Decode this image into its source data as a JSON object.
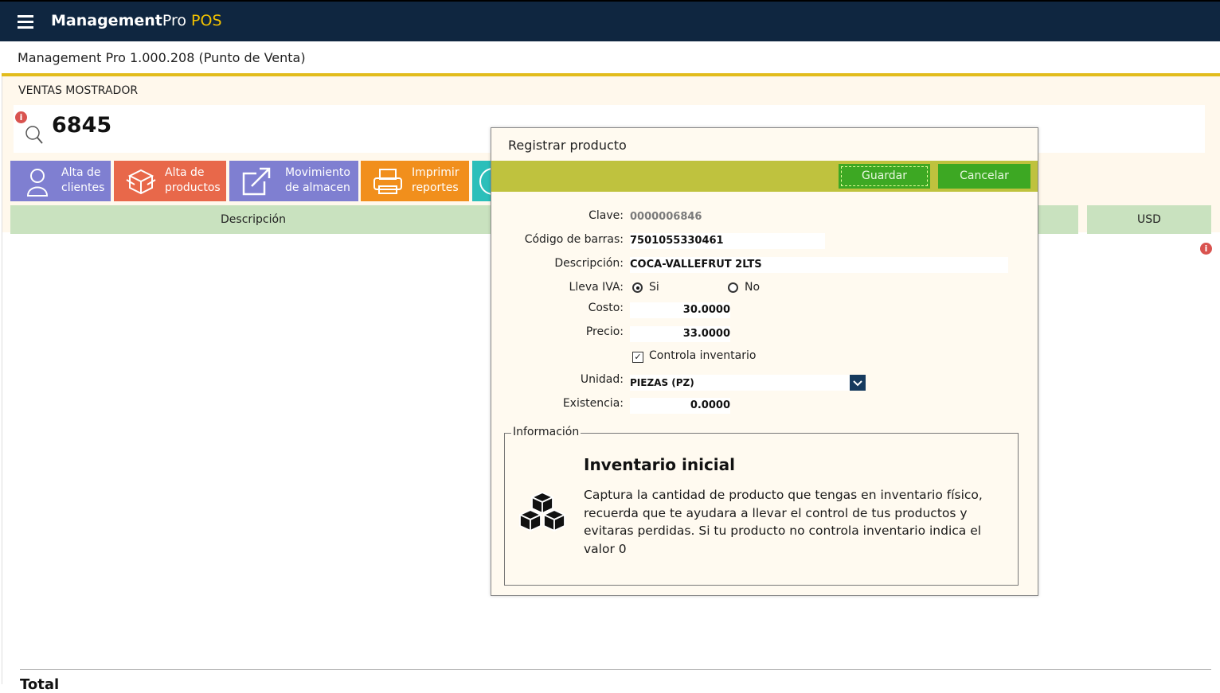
{
  "app": {
    "brand_bold": "Management",
    "brand_regular": "Pro",
    "brand_accent": " POS",
    "version": "Management Pro 1.000.208 (Punto de Venta)"
  },
  "sales": {
    "section_title": "VENTAS MOSTRADOR",
    "search_value": "6845",
    "info_icon_glyph": "i"
  },
  "tiles": [
    {
      "label": "Alta de\nclientes",
      "icon": "user-icon",
      "color": "#7f7fd1"
    },
    {
      "label": "Alta de\nproductos",
      "icon": "box-icon",
      "color": "#e8684a"
    },
    {
      "label": "Movimiento\nde almacen",
      "icon": "external-link-icon",
      "color": "#7f7fd1"
    },
    {
      "label": "Imprimir\nreportes",
      "icon": "printer-icon",
      "color": "#f18f1c"
    },
    {
      "label": "",
      "icon": "circle-icon",
      "color": "#2bbfba"
    }
  ],
  "grid": {
    "headers": [
      "Descripción",
      "USD"
    ]
  },
  "footer": {
    "total_label": "Total"
  },
  "dialog": {
    "title": "Registrar producto",
    "save_label": "Guardar",
    "cancel_label": "Cancelar",
    "fields": {
      "clave_label": "Clave:",
      "clave_value": "0000006846",
      "barcode_label": "Código de barras:",
      "barcode_value": "7501055330461",
      "description_label": "Descripción:",
      "description_value": "COCA-VALLEFRUT 2LTS",
      "iva_label": "Lleva IVA:",
      "iva_yes": "Si",
      "iva_no": "No",
      "iva_selected": "Si",
      "cost_label": "Costo:",
      "cost_value": "30.0000",
      "price_label": "Precio:",
      "price_value": "33.0000",
      "inventory_control_label": "Controla inventario",
      "inventory_control_checked": true,
      "unit_label": "Unidad:",
      "unit_value": "PIEZAS (PZ)",
      "stock_label": "Existencia:",
      "stock_value": "0.0000"
    },
    "info": {
      "legend": "Información",
      "heading": "Inventario inicial",
      "body": "Captura la cantidad de producto que tengas en inventario físico, recuerda que te ayudara a llevar el control de tus productos y evitaras perdidas. Si tu producto no controla inventario indica el valor 0"
    }
  },
  "colors": {
    "topbar": "#0f2640",
    "accent_yellow": "#e2bc1c",
    "dialog_toolbar": "#bfc23e",
    "button_green": "#3da823",
    "grid_header": "#c9e2bf"
  }
}
